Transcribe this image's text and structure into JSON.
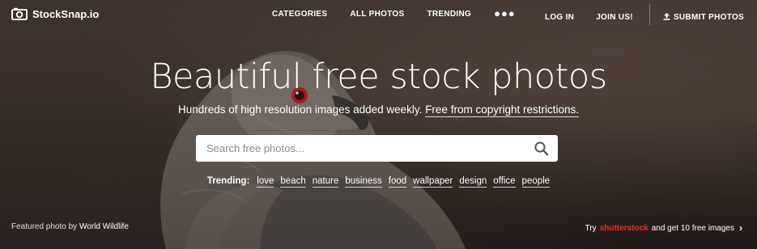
{
  "brand": {
    "name": "StockSnap.io",
    "icon": "camera-icon"
  },
  "nav": {
    "items": [
      "CATEGORIES",
      "ALL PHOTOS",
      "TRENDING"
    ],
    "more_icon": "more-dots-icon",
    "login": "LOG IN",
    "join": "JOIN US!",
    "submit": "SUBMIT PHOTOS",
    "submit_icon": "upload-icon"
  },
  "hero": {
    "title": "Beautiful free stock photos",
    "subtitle_text": "Hundreds of high resolution images added weekly.",
    "subtitle_link": "Free from copyright restrictions."
  },
  "search": {
    "placeholder": "Search free photos...",
    "value": "",
    "icon": "search-icon"
  },
  "trending": {
    "label": "Trending:",
    "tags": [
      "love",
      "beach",
      "nature",
      "business",
      "food",
      "wallpaper",
      "design",
      "office",
      "people"
    ]
  },
  "footer": {
    "credit_prefix": "Featured photo by",
    "credit_author": "World Wildlife",
    "promo_prefix": "Try",
    "promo_brand": "shutterstock",
    "promo_suffix": "and get 10 free images",
    "promo_icon": "chevron-right-icon"
  },
  "colors": {
    "accent_promo": "#ee2b24",
    "background": "#3f332c",
    "search_bg": "#ffffff"
  }
}
